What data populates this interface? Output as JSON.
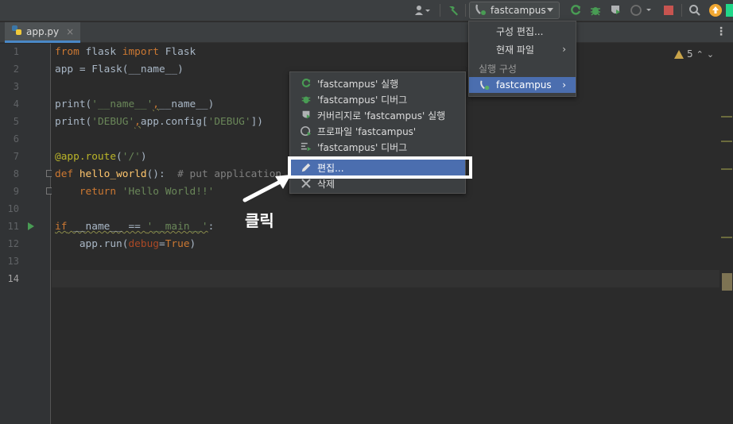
{
  "toolbar": {
    "run_config_name": "fastcampus",
    "icons": [
      "user-icon",
      "build-hammer-icon",
      "python-icon",
      "rerun-icon",
      "debug-icon",
      "coverage-icon",
      "profile-icon",
      "stop-icon",
      "search-icon",
      "update-icon",
      "ide-logo-icon"
    ]
  },
  "tab": {
    "filename": "app.py",
    "close": "×"
  },
  "editor": {
    "line_numbers": [
      "1",
      "2",
      "3",
      "4",
      "5",
      "6",
      "7",
      "8",
      "9",
      "10",
      "11",
      "12",
      "13",
      "14"
    ],
    "current_line": "14",
    "warning_count": "5",
    "lines": [
      [
        {
          "t": "from",
          "c": "kw"
        },
        {
          "t": " flask ",
          "c": ""
        },
        {
          "t": "import",
          "c": "kw"
        },
        {
          "t": " Flask",
          "c": ""
        }
      ],
      [
        {
          "t": "app = Flask(__name__)",
          "c": ""
        }
      ],
      [],
      [
        {
          "t": "print(",
          "c": ""
        },
        {
          "t": "'__name__'",
          "c": "str"
        },
        {
          "t": ",",
          "c": "kw squig"
        },
        {
          "t": "__name__)",
          "c": ""
        }
      ],
      [
        {
          "t": "print(",
          "c": ""
        },
        {
          "t": "'DEBUG'",
          "c": "str"
        },
        {
          "t": ",",
          "c": "kw squig"
        },
        {
          "t": "app.config[",
          "c": ""
        },
        {
          "t": "'DEBUG'",
          "c": "str"
        },
        {
          "t": "])",
          "c": ""
        }
      ],
      [],
      [
        {
          "t": "@app.route",
          "c": "dec"
        },
        {
          "t": "(",
          "c": ""
        },
        {
          "t": "'/'",
          "c": "str"
        },
        {
          "t": ")",
          "c": ""
        }
      ],
      [
        {
          "t": "def",
          "c": "kw"
        },
        {
          "t": " ",
          "c": ""
        },
        {
          "t": "hello_world",
          "c": "fn"
        },
        {
          "t": "():  ",
          "c": ""
        },
        {
          "t": "# put application",
          "c": "cmt"
        }
      ],
      [
        {
          "t": "    ",
          "c": ""
        },
        {
          "t": "return",
          "c": "kw"
        },
        {
          "t": " ",
          "c": ""
        },
        {
          "t": "'Hello World!!'",
          "c": "str"
        }
      ],
      [],
      [
        {
          "t": "if",
          "c": "kw squig"
        },
        {
          "t": " __name__ == ",
          "c": "squig"
        },
        {
          "t": "'__main__'",
          "c": "str squig"
        },
        {
          "t": ":",
          "c": ""
        }
      ],
      [
        {
          "t": "    app.run(",
          "c": ""
        },
        {
          "t": "debug",
          "c": "param"
        },
        {
          "t": "=",
          "c": ""
        },
        {
          "t": "True",
          "c": "kw"
        },
        {
          "t": ")",
          "c": ""
        }
      ],
      [],
      []
    ]
  },
  "run_config_menu": {
    "items": [
      {
        "label": "구성 편집...",
        "submenu": false
      },
      {
        "label": "현재 파일",
        "submenu": true
      },
      {
        "label": "실행 구성",
        "header": true
      },
      {
        "label": "fastcampus",
        "submenu": true,
        "selected": true
      }
    ]
  },
  "context_menu": {
    "items": [
      {
        "label": "'fastcampus' 실행",
        "icon": "run-icon"
      },
      {
        "label": "'fastcampus' 디버그",
        "icon": "debug-icon"
      },
      {
        "label": "커버리지로 'fastcampus' 실행",
        "icon": "coverage-icon"
      },
      {
        "label": "프로파일 'fastcampus'",
        "icon": "profile-icon"
      },
      {
        "label": "'fastcampus' 디버그",
        "icon": "concurrency-icon"
      },
      {
        "label": "편집...",
        "icon": "edit-icon",
        "selected": true
      },
      {
        "label": "삭제",
        "icon": "delete-icon"
      }
    ]
  },
  "annotation": {
    "label": "클릭"
  },
  "colors": {
    "accent": "#4b6eaf",
    "run_green": "#499c54",
    "stop_red": "#c75450"
  }
}
